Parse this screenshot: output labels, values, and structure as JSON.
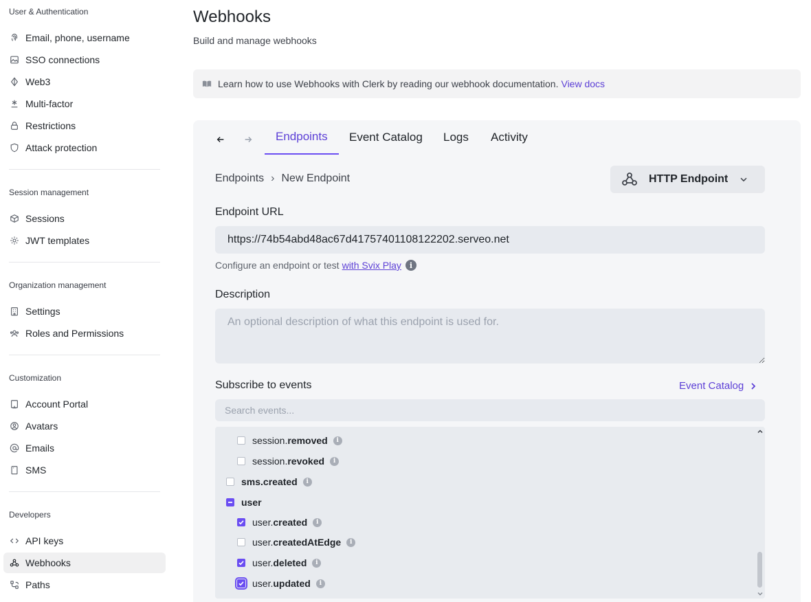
{
  "sidebar": {
    "sections": [
      {
        "title": "User & Authentication",
        "items": [
          {
            "label": "Email, phone, username",
            "icon": "fingerprint-icon"
          },
          {
            "label": "SSO connections",
            "icon": "image-icon"
          },
          {
            "label": "Web3",
            "icon": "diamond-icon"
          },
          {
            "label": "Multi-factor",
            "icon": "asterisk-icon"
          },
          {
            "label": "Restrictions",
            "icon": "lock-icon"
          },
          {
            "label": "Attack protection",
            "icon": "shield-icon"
          }
        ]
      },
      {
        "title": "Session management",
        "items": [
          {
            "label": "Sessions",
            "icon": "box-icon"
          },
          {
            "label": "JWT templates",
            "icon": "gear-icon"
          }
        ]
      },
      {
        "title": "Organization management",
        "items": [
          {
            "label": "Settings",
            "icon": "building-icon"
          },
          {
            "label": "Roles and Permissions",
            "icon": "users-icon"
          }
        ]
      },
      {
        "title": "Customization",
        "items": [
          {
            "label": "Account Portal",
            "icon": "portal-icon"
          },
          {
            "label": "Avatars",
            "icon": "user-circle-icon"
          },
          {
            "label": "Emails",
            "icon": "at-icon"
          },
          {
            "label": "SMS",
            "icon": "phone-icon"
          }
        ]
      },
      {
        "title": "Developers",
        "items": [
          {
            "label": "API keys",
            "icon": "code-icon"
          },
          {
            "label": "Webhooks",
            "icon": "webhook-icon",
            "active": true
          },
          {
            "label": "Paths",
            "icon": "paths-icon"
          }
        ]
      }
    ]
  },
  "header": {
    "title": "Webhooks",
    "subtitle": "Build and manage webhooks"
  },
  "banner": {
    "text": "Learn how to use Webhooks with Clerk by reading our webhook documentation.",
    "link": "View docs"
  },
  "tabs": [
    {
      "label": "Endpoints",
      "active": true
    },
    {
      "label": "Event Catalog"
    },
    {
      "label": "Logs"
    },
    {
      "label": "Activity"
    }
  ],
  "breadcrumb": {
    "parent": "Endpoints",
    "separator": "›",
    "current": "New Endpoint"
  },
  "endpoint_type": {
    "label": "HTTP Endpoint"
  },
  "form": {
    "url_label": "Endpoint URL",
    "url_value": "https://74b54abd48ac67d41757401108122202.serveo.net",
    "helper_text": "Configure an endpoint or test",
    "helper_link": "with Svix Play",
    "description_label": "Description",
    "description_placeholder": "An optional description of what this endpoint is used for.",
    "subscribe_label": "Subscribe to events",
    "event_catalog_link": "Event Catalog",
    "search_placeholder": "Search events..."
  },
  "events": [
    {
      "prefix": "session.",
      "name": "removed",
      "checked": false,
      "level": 1
    },
    {
      "prefix": "session.",
      "name": "revoked",
      "checked": false,
      "level": 1
    },
    {
      "prefix": "",
      "name": "sms.created",
      "checked": false,
      "level": 0
    },
    {
      "prefix": "",
      "name": "user",
      "checked": "indeterminate",
      "level": 0
    },
    {
      "prefix": "user.",
      "name": "created",
      "checked": true,
      "level": 1
    },
    {
      "prefix": "user.",
      "name": "createdAtEdge",
      "checked": false,
      "level": 1
    },
    {
      "prefix": "user.",
      "name": "deleted",
      "checked": true,
      "level": 1
    },
    {
      "prefix": "user.",
      "name": "updated",
      "checked": true,
      "level": 1
    }
  ],
  "colors": {
    "accent": "#6a4df2",
    "link": "#5c3fd6",
    "panel_bg": "#f5f6f8"
  }
}
